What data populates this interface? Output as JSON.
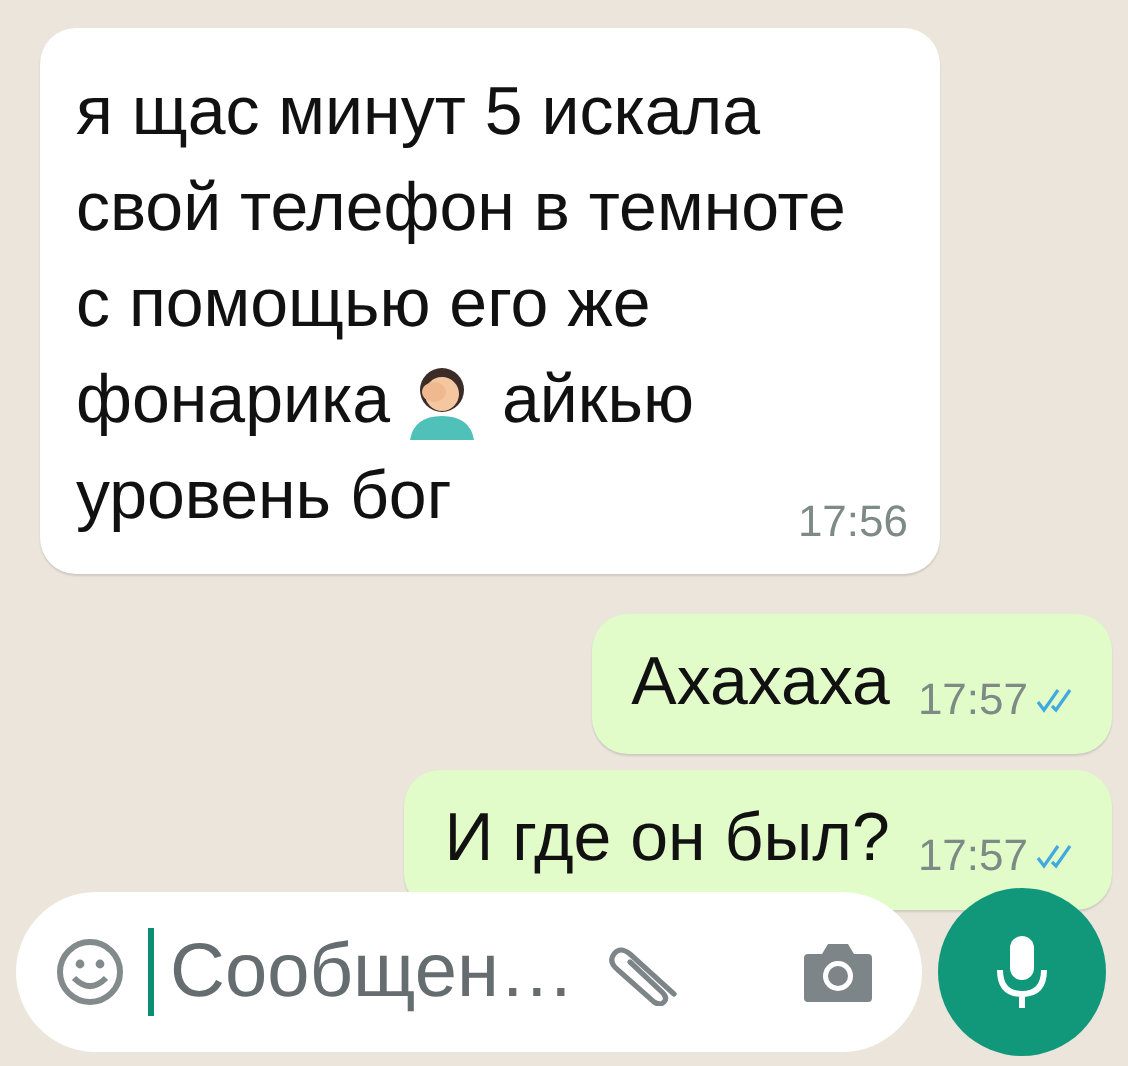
{
  "messages": [
    {
      "kind": "incoming",
      "lines": [
        {
          "parts": [
            {
              "kind": "text",
              "text": "я щас минут 5 искала свой телефон в темноте с помощью его же"
            }
          ]
        },
        {
          "parts": [
            {
              "kind": "text",
              "text": "фонарика"
            },
            {
              "kind": "emoji"
            },
            {
              "kind": "text",
              "text": "айкью"
            }
          ]
        },
        {
          "parts": [
            {
              "kind": "text",
              "text": "уровень бог"
            }
          ]
        }
      ],
      "time": "17:56"
    },
    {
      "kind": "outgoing",
      "parts": [
        {
          "kind": "text",
          "text": "Ахахаха"
        }
      ],
      "time": "17:57",
      "read": true
    },
    {
      "kind": "outgoing",
      "parts": [
        {
          "kind": "text",
          "text": "И где он был?"
        }
      ],
      "time": "17:57",
      "read": true
    }
  ],
  "composer": {
    "placeholder": "Сообщен…"
  }
}
